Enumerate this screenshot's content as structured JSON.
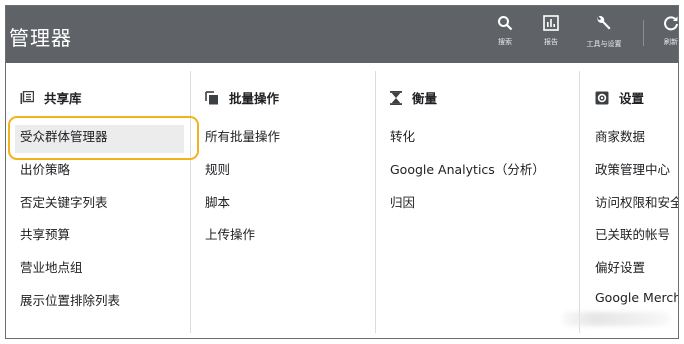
{
  "header": {
    "title": "管理器",
    "tools": [
      {
        "icon": "search-icon",
        "label": "搜索"
      },
      {
        "icon": "reports-icon",
        "label": "报告"
      },
      {
        "icon": "wrench-icon",
        "label": "工具与设置"
      },
      {
        "icon": "refresh-icon",
        "label": "刷新"
      }
    ]
  },
  "columns": [
    {
      "heading": "共享库",
      "icon": "library-icon",
      "items": [
        "受众群体管理器",
        "出价策略",
        "否定关键字列表",
        "共享预算",
        "营业地点组",
        "展示位置排除列表"
      ]
    },
    {
      "heading": "批量操作",
      "icon": "copy-icon",
      "items": [
        "所有批量操作",
        "规则",
        "脚本",
        "上传操作"
      ]
    },
    {
      "heading": "衡量",
      "icon": "hourglass-icon",
      "items": [
        "转化",
        "Google Analytics（分析）",
        "归因"
      ]
    },
    {
      "heading": "设置",
      "icon": "gear-icon",
      "items": [
        "商家数据",
        "政策管理中心",
        "访问权限和安全",
        "已关联的帐号",
        "偏好设置",
        "Google Merchant"
      ]
    }
  ],
  "highlight": {
    "item": "受众群体管理器",
    "ring_color": "#f2b21c"
  },
  "colors": {
    "topbar": "#5f6368",
    "text": "#202124",
    "divider": "#dadce0"
  }
}
